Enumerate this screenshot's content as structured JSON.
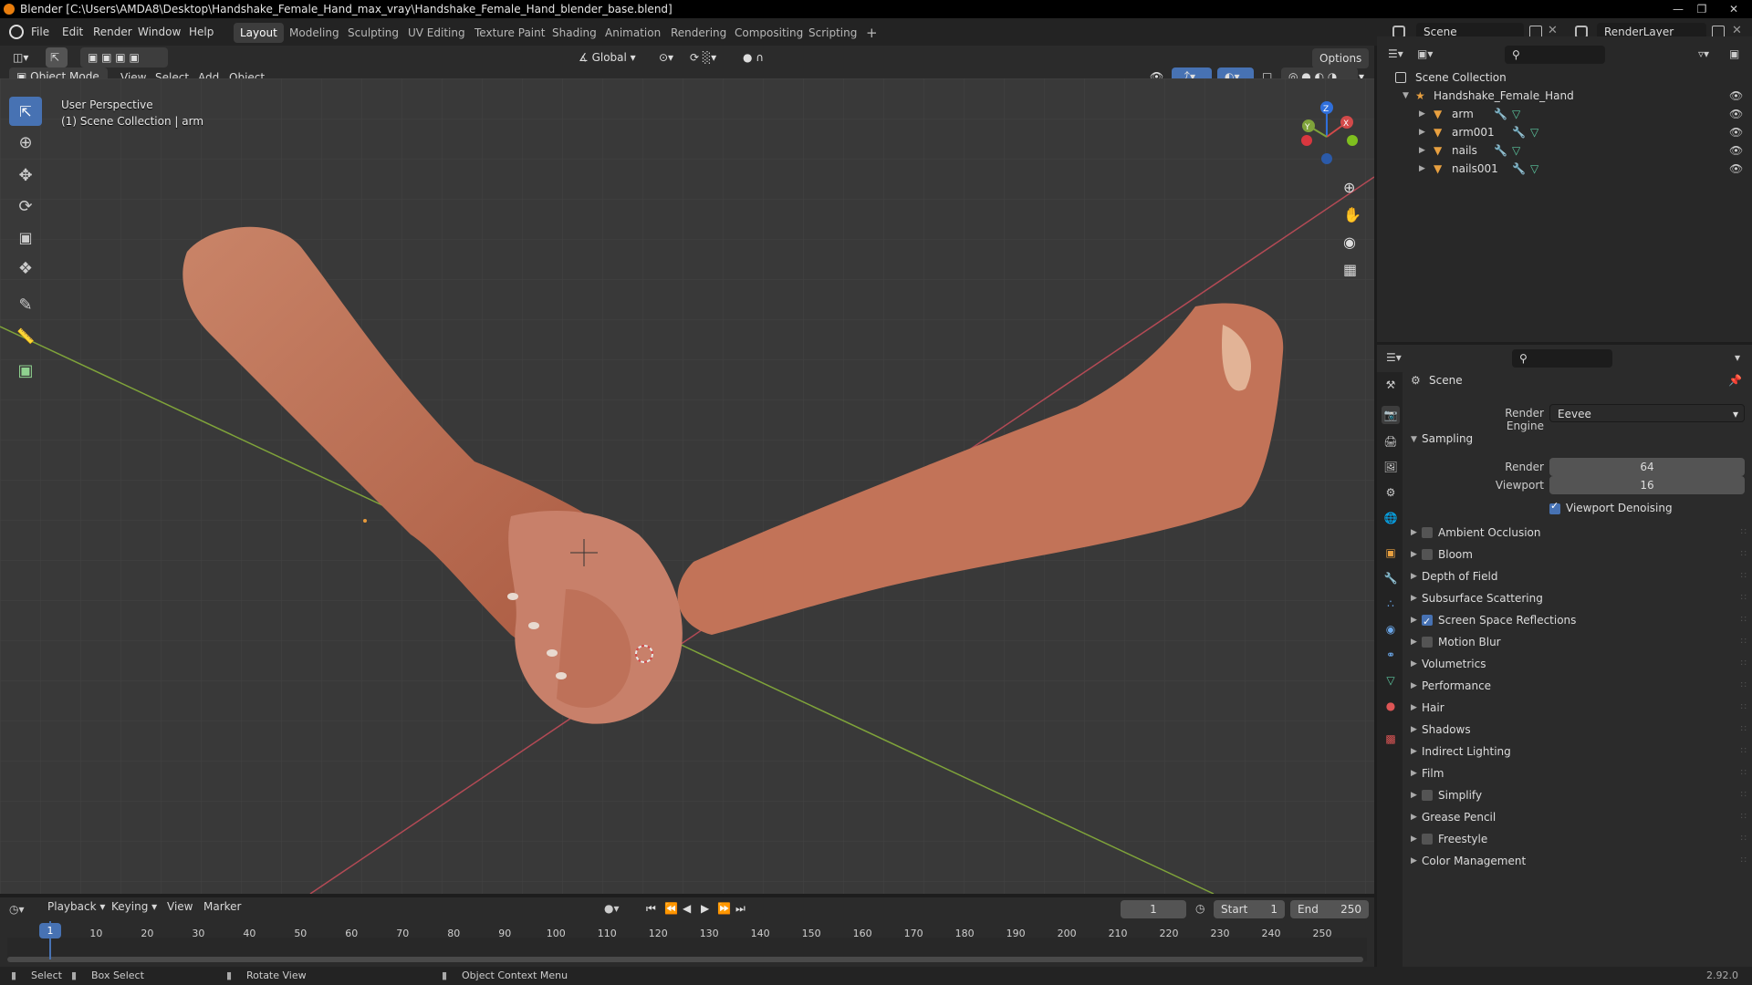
{
  "window": {
    "title": "Blender [C:\\Users\\AMDA8\\Desktop\\Handshake_Female_Hand_max_vray\\Handshake_Female_Hand_blender_base.blend]"
  },
  "menu": {
    "items": [
      "File",
      "Edit",
      "Render",
      "Window",
      "Help"
    ]
  },
  "workspaces": {
    "tabs": [
      "Layout",
      "Modeling",
      "Sculpting",
      "UV Editing",
      "Texture Paint",
      "Shading",
      "Animation",
      "Rendering",
      "Compositing",
      "Scripting"
    ],
    "active": "Layout"
  },
  "scene": {
    "name": "Scene",
    "view_layer": "RenderLayer"
  },
  "header3d": {
    "transform_orientation": "Global",
    "options_label": "Options",
    "mode": "Object Mode",
    "menus": [
      "View",
      "Select",
      "Add",
      "Object"
    ]
  },
  "viewport": {
    "perspective": "User Perspective",
    "collection_info": "(1) Scene Collection | arm"
  },
  "outliner": {
    "root": "Scene Collection",
    "collection": "Handshake_Female_Hand",
    "objects": [
      "arm",
      "arm001",
      "nails",
      "nails001"
    ]
  },
  "properties": {
    "header": "Scene",
    "render_engine_label": "Render Engine",
    "render_engine": "Eevee",
    "sampling_label": "Sampling",
    "render_label": "Render",
    "render_samples": "64",
    "viewport_label": "Viewport",
    "viewport_samples": "16",
    "viewport_denoising": "Viewport Denoising",
    "panels": [
      {
        "label": "Ambient Occlusion",
        "checkbox": true,
        "checked": false
      },
      {
        "label": "Bloom",
        "checkbox": true,
        "checked": false
      },
      {
        "label": "Depth of Field",
        "checkbox": false
      },
      {
        "label": "Subsurface Scattering",
        "checkbox": false
      },
      {
        "label": "Screen Space Reflections",
        "checkbox": true,
        "checked": true
      },
      {
        "label": "Motion Blur",
        "checkbox": true,
        "checked": false
      },
      {
        "label": "Volumetrics",
        "checkbox": false
      },
      {
        "label": "Performance",
        "checkbox": false
      },
      {
        "label": "Hair",
        "checkbox": false
      },
      {
        "label": "Shadows",
        "checkbox": false
      },
      {
        "label": "Indirect Lighting",
        "checkbox": false
      },
      {
        "label": "Film",
        "checkbox": false
      },
      {
        "label": "Simplify",
        "checkbox": true,
        "checked": false
      },
      {
        "label": "Grease Pencil",
        "checkbox": false
      },
      {
        "label": "Freestyle",
        "checkbox": true,
        "checked": false
      },
      {
        "label": "Color Management",
        "checkbox": false
      }
    ]
  },
  "timeline": {
    "menus": [
      "Playback",
      "Keying",
      "View",
      "Marker"
    ],
    "current_frame": "1",
    "start_label": "Start",
    "start": "1",
    "end_label": "End",
    "end": "250",
    "ticks": [
      "1",
      "10",
      "20",
      "30",
      "40",
      "50",
      "60",
      "70",
      "80",
      "90",
      "100",
      "110",
      "120",
      "130",
      "140",
      "150",
      "160",
      "170",
      "180",
      "190",
      "200",
      "210",
      "220",
      "230",
      "240",
      "250"
    ]
  },
  "statusbar": {
    "select": "Select",
    "box_select": "Box Select",
    "rotate_view": "Rotate View",
    "context_menu": "Object Context Menu",
    "version": "2.92.0"
  },
  "colors": {
    "accent": "#4772b3",
    "x_axis": "#b34a55",
    "y_axis": "#7fa33a",
    "skin": "#c77a5e"
  }
}
